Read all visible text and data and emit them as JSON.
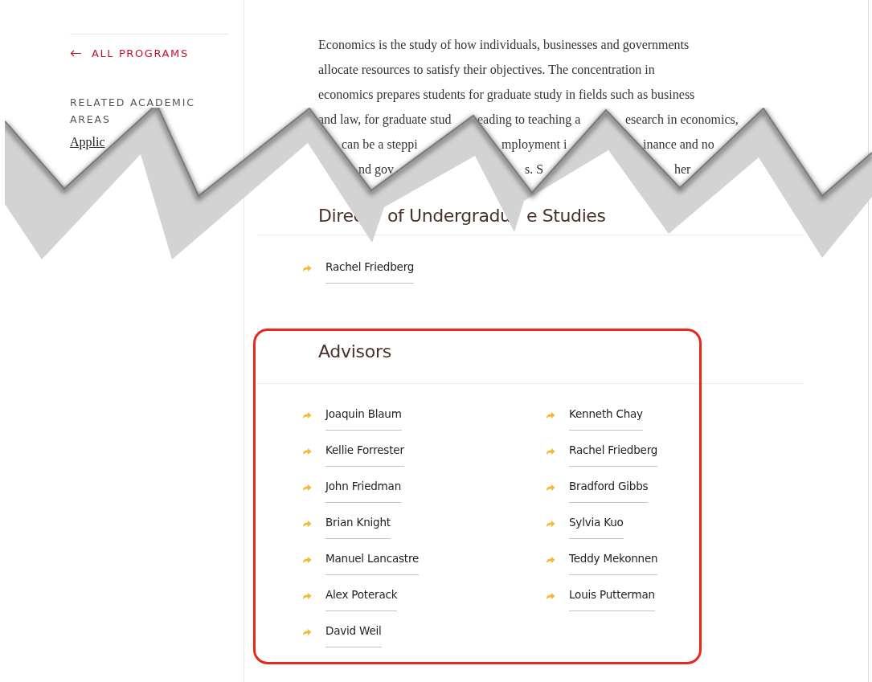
{
  "sidebar": {
    "back_link": "ALL PROGRAMS",
    "related_heading": "RELATED ACADEMIC AREAS",
    "related_links": [
      "Applic"
    ]
  },
  "intro": {
    "lines": [
      [
        "Economics is the study of how individuals, businesses and governments"
      ],
      [
        "allocate resources to satisfy their objectives. The concentration in"
      ],
      [
        "economics prepares students for graduate study in fields such as business"
      ],
      [
        "and law, for graduate stud",
        "eading to teaching a",
        "esearch in economics,"
      ],
      [
        "can be a steppi",
        "mployment i",
        "inance and no"
      ],
      [
        "nd gov",
        "s. S",
        "her"
      ]
    ]
  },
  "directors": {
    "heading": [
      "Direc",
      "of Undergradu",
      "e Studies"
    ],
    "people": [
      "Rachel Friedberg"
    ]
  },
  "advisors": {
    "heading": "Advisors",
    "highlighted": true,
    "columns": [
      [
        "Joaquin Blaum",
        "Kellie Forrester",
        "John Friedman",
        "Brian Knight",
        "Manuel Lancastre",
        "Alex Poterack",
        "David Weil"
      ],
      [
        "Kenneth Chay",
        "Rachel Friedberg",
        "Bradford Gibbs",
        "Sylvia Kuo",
        "Teddy Mekonnen",
        "Louis Putterman"
      ]
    ]
  }
}
